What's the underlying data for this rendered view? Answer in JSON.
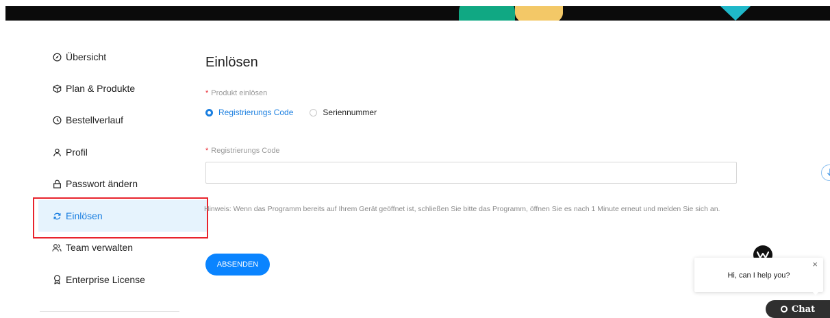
{
  "sidebar": {
    "items": [
      {
        "label": "Übersicht",
        "icon": "compass-icon"
      },
      {
        "label": "Plan & Produkte",
        "icon": "box-icon"
      },
      {
        "label": "Bestellverlauf",
        "icon": "clock-icon"
      },
      {
        "label": "Profil",
        "icon": "user-icon"
      },
      {
        "label": "Passwort ändern",
        "icon": "lock-icon"
      },
      {
        "label": "Einlösen",
        "icon": "refresh-icon",
        "active": true
      },
      {
        "label": "Team verwalten",
        "icon": "team-icon"
      },
      {
        "label": "Enterprise License",
        "icon": "award-icon"
      }
    ]
  },
  "main": {
    "title": "Einlösen",
    "product_label": "Produkt einlösen",
    "radio_options": [
      {
        "label": "Registrierungs Code",
        "checked": true
      },
      {
        "label": "Seriennummer",
        "checked": false
      }
    ],
    "code_label": "Registrierungs Code",
    "code_value": "",
    "required_mark": "*",
    "hint": "Hinweis: Wenn das Programm bereits auf Ihrem Gerät geöffnet ist, schließen Sie bitte das Programm, öffnen Sie es nach 1 Minute erneut und melden Sie sich an.",
    "submit_label": "ABSENDEN"
  },
  "chat": {
    "message": "Hi, can I help you?",
    "close": "×",
    "button_label": "Chat"
  },
  "colors": {
    "accent": "#0a84ff",
    "active_bg": "#e6f3fd",
    "highlight_outline": "#e8232c",
    "required": "#e8232c"
  }
}
